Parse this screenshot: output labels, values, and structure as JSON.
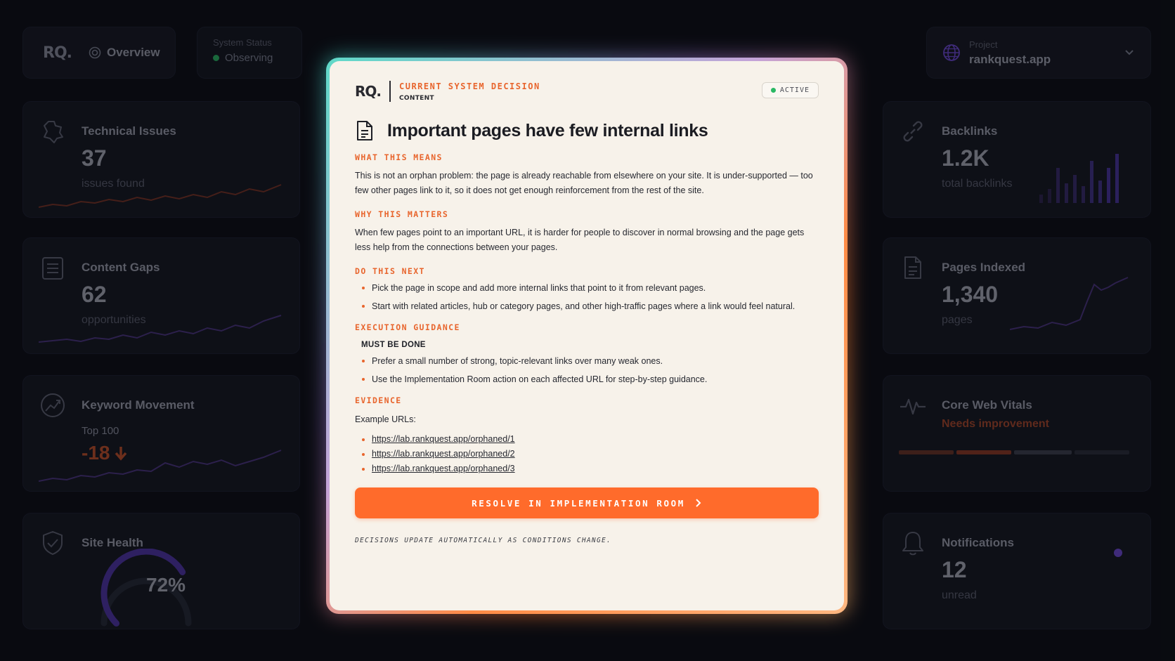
{
  "topbar": {
    "logo": "RQ.",
    "nav_label": "Overview",
    "status_label": "System Status",
    "status_value": "Observing",
    "project_label": "Project",
    "project_name": "rankquest.app"
  },
  "left_cards": [
    {
      "title": "Technical Issues",
      "value": "37",
      "sub": "issues found",
      "icon": "puzzle-icon"
    },
    {
      "title": "Content Gaps",
      "value": "62",
      "sub": "opportunities",
      "icon": "document-list-icon"
    },
    {
      "title": "Keyword Movement",
      "label": "Top 100",
      "value": "-18",
      "icon": "trend-icon"
    },
    {
      "title": "Site Health",
      "value": "72%",
      "progress": 0.72,
      "icon": "shield-check-icon"
    }
  ],
  "right_cards": [
    {
      "title": "Backlinks",
      "value": "1.2K",
      "sub": "total backlinks",
      "icon": "link-icon"
    },
    {
      "title": "Pages Indexed",
      "value": "1,340",
      "sub": "pages",
      "icon": "document-icon"
    },
    {
      "title": "Core Web Vitals",
      "status": "Needs improvement",
      "icon": "pulse-icon"
    },
    {
      "title": "Notifications",
      "value": "12",
      "sub": "unread",
      "icon": "bell-icon"
    }
  ],
  "modal": {
    "logo": "RQ.",
    "header_title": "CURRENT SYSTEM DECISION",
    "header_sub": "CONTENT",
    "badge": "ACTIVE",
    "title": "Important pages have few internal links",
    "sections": {
      "what_heading": "WHAT THIS MEANS",
      "what_text": "This is not an orphan problem: the page is already reachable from elsewhere on your site. It is under-supported — too few other pages link to it, so it does not get enough reinforcement from the rest of the site.",
      "why_heading": "WHY THIS MATTERS",
      "why_text": "When few pages point to an important URL, it is harder for people to discover in normal browsing and the page gets less help from the connections between your pages.",
      "next_heading": "DO THIS NEXT",
      "next_items": [
        "Pick the page in scope and add more internal links that point to it from relevant pages.",
        "Start with related articles, hub or category pages, and other high-traffic pages where a link would feel natural."
      ],
      "guidance_heading": "EXECUTION GUIDANCE",
      "must_label": "MUST BE DONE",
      "guidance_items": [
        "Prefer a small number of strong, topic-relevant links over many weak ones.",
        "Use the Implementation Room action on each affected URL for step-by-step guidance."
      ],
      "evidence_heading": "EVIDENCE",
      "evidence_label": "Example URLs:",
      "urls": [
        "https://lab.rankquest.app/orphaned/1",
        "https://lab.rankquest.app/orphaned/2",
        "https://lab.rankquest.app/orphaned/3"
      ]
    },
    "cta_label": "RESOLVE IN IMPLEMENTATION ROOM",
    "footnote": "DECISIONS UPDATE AUTOMATICALLY AS CONDITIONS CHANGE."
  },
  "colors": {
    "accent": "#ff6b2b",
    "accent_text": "#e8652d",
    "active": "#2ab864",
    "negative": "#d9532b",
    "purple": "#6e4ad6"
  }
}
